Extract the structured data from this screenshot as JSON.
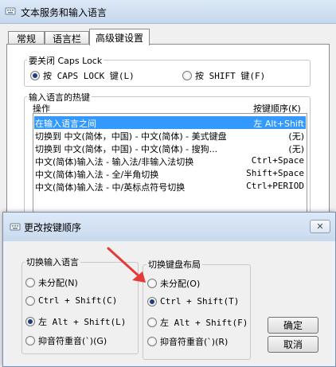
{
  "main_window": {
    "title": "文本服务和输入语言",
    "tabs": [
      {
        "label": "常规",
        "active": false
      },
      {
        "label": "语言栏",
        "active": false
      },
      {
        "label": "高级键设置",
        "active": true
      }
    ],
    "caps_group": {
      "legend": "要关闭 Caps Lock",
      "options": [
        {
          "label": "按 CAPS LOCK 键(L)",
          "checked": true
        },
        {
          "label": "按 SHIFT 键(F)",
          "checked": false
        }
      ]
    },
    "hotkey_group": {
      "legend": "输入语言的热键",
      "col_action": "操作",
      "col_sequence": "按键顺序(K)",
      "rows": [
        {
          "action": "在输入语言之间",
          "keys": "左 Alt+Shift",
          "selected": true
        },
        {
          "action": "切换到 中文(简体，中国) - 中文(简体) - 美式键盘",
          "keys": "(无)",
          "selected": false
        },
        {
          "action": "切换到 中文(简体，中国) - 中文(简体) - 搜狗...",
          "keys": "(无)",
          "selected": false
        },
        {
          "action": "中文(简体)输入法 - 输入法/非输入法切换",
          "keys": "Ctrl+Space",
          "selected": false
        },
        {
          "action": "中文(简体)输入法 - 全/半角切换",
          "keys": "Shift+Space",
          "selected": false
        },
        {
          "action": "中文(简体)输入法 - 中/英标点符号切换",
          "keys": "Ctrl+PERIOD",
          "selected": false
        }
      ]
    }
  },
  "dialog": {
    "title": "更改按键顺序",
    "close_glyph": "✕",
    "input_lang_group": {
      "legend": "切换输入语言",
      "options": [
        {
          "label": "未分配(N)",
          "checked": false
        },
        {
          "label": "Ctrl + Shift(C)",
          "checked": false
        },
        {
          "label": "左 Alt + Shift(L)",
          "checked": true
        },
        {
          "label": "抑音符重音(`)(G)",
          "checked": false
        }
      ]
    },
    "layout_group": {
      "legend": "切换键盘布局",
      "options": [
        {
          "label": "未分配(O)",
          "checked": false
        },
        {
          "label": "Ctrl + Shift(T)",
          "checked": true
        },
        {
          "label": "左 Alt + Shift(F)",
          "checked": false
        },
        {
          "label": "抑音符重音(`)(R)",
          "checked": false
        }
      ]
    },
    "ok_label": "确定",
    "cancel_label": "取消"
  },
  "annotation_color": "#e53a3a"
}
